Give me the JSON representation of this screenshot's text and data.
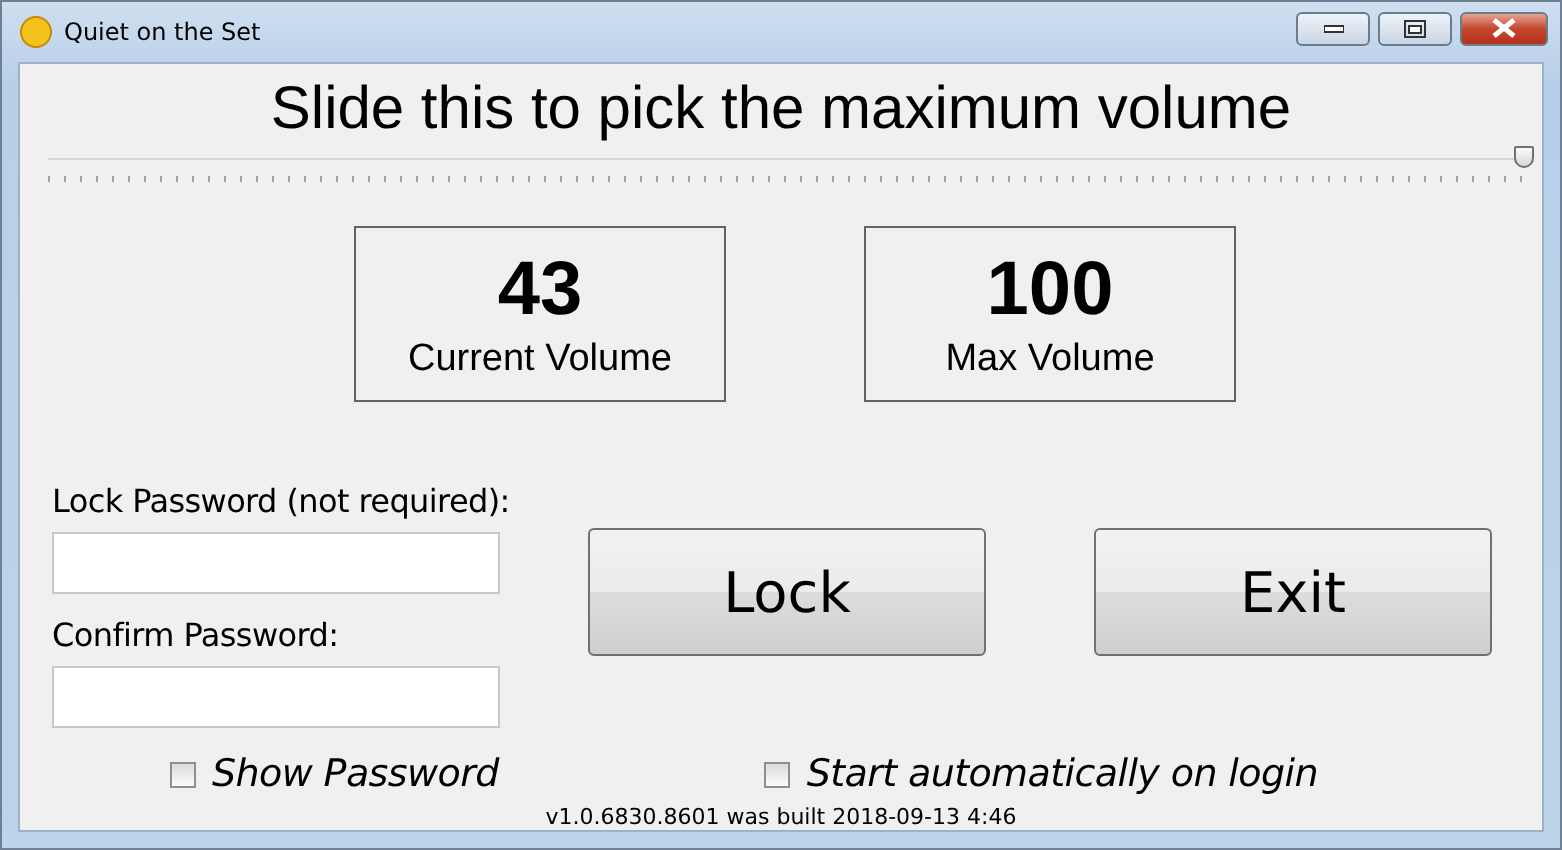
{
  "window": {
    "title": "Quiet on the Set"
  },
  "heading": "Slide this to pick the maximum volume",
  "slider": {
    "level": 1.0
  },
  "readouts": [
    {
      "value": "43",
      "label": "Current Volume"
    },
    {
      "value": "100",
      "label": "Max Volume"
    }
  ],
  "fields": [
    {
      "label": "Lock Password (not required):"
    },
    {
      "label": "Confirm Password:"
    }
  ],
  "buttons": [
    "Lock",
    "Exit"
  ],
  "checkboxes": [
    {
      "label": "Show Password",
      "checked": false
    },
    {
      "label": "Start automatically on login",
      "checked": false
    }
  ],
  "status": "v1.0.6830.8601 was built 2018-09-13 4:46"
}
